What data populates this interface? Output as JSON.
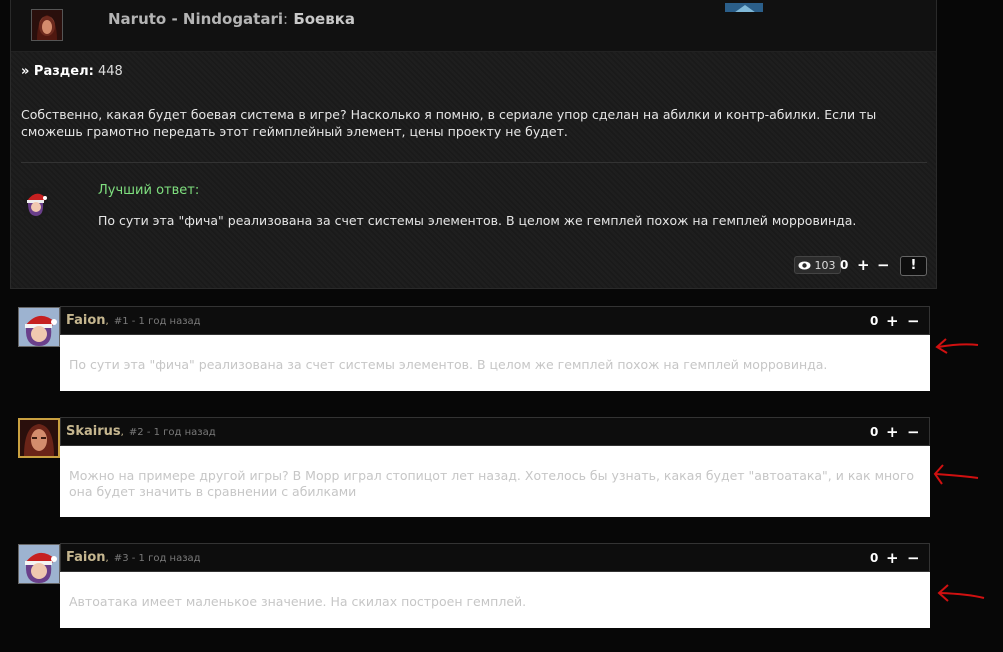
{
  "question": {
    "game": "Naruto - Nindogatari",
    "colon": ":",
    "topic": "Боевка",
    "section_label": "» Раздел:",
    "section_value": "448",
    "body": "Собственно, какая будет боевая система в игре? Насколько я помню, в сериале упор сделан на абилки и контр-абилки. Если ты сможешь грамотно передать этот геймплейный элемент, цены проекту не будет.",
    "best_answer_label": "Лучший ответ:",
    "best_answer_text": "По сути эта \"фича\" реализована за счет системы элементов. В целом же гемплей похож на гемплей морровинда.",
    "views": "103",
    "score": "0",
    "plus": "+",
    "minus": "−",
    "report": "!"
  },
  "comments": [
    {
      "author": "Faion",
      "meta": "#1 - 1 год назад",
      "score": "0",
      "text": "По сути эта \"фича\" реализована за счет системы элементов. В целом же гемплей похож на гемплей морровинда."
    },
    {
      "author": "Skairus",
      "meta": "#2 - 1 год назад",
      "score": "0",
      "text": "Можно на примере другой игры? В Морр играл стопицот лет назад. Хотелось бы узнать, какая будет \"автоатака\", и как много она будет значить в сравнении с абилками"
    },
    {
      "author": "Faion",
      "meta": "#3 - 1 год назад",
      "score": "0",
      "text": "Автоатака имеет маленькое значение. На скилах построен гемплей."
    }
  ],
  "icons": {
    "eye": "eye-icon",
    "arrow": "red-arrow-annotation"
  },
  "colors": {
    "best_answer": "#7fe07f",
    "author": "#c5b68f",
    "annotation": "#d01010"
  }
}
